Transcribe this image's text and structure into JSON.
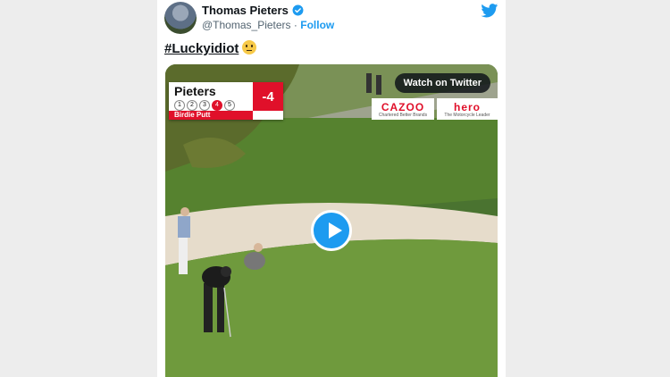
{
  "tweet": {
    "author_name": "Thomas Pieters",
    "handle": "@Thomas_Pieters",
    "separator": "·",
    "follow_label": "Follow",
    "hashtag": "#Luckyidiot",
    "emoji": "face-with-rolling-eyes-emoji"
  },
  "video": {
    "watch_label": "Watch on Twitter",
    "scoreboard": {
      "player": "Pieters",
      "holes": [
        "1",
        "2",
        "3",
        "4",
        "5"
      ],
      "current_hole_index": 3,
      "score": "-4",
      "status": "Birdie Putt"
    },
    "ads": {
      "left_brand": "CAZOO",
      "left_sub": "Chartered Better Brands",
      "right_brand": "hero",
      "right_sub": "The Motorcycle Leader"
    }
  },
  "colors": {
    "twitter_blue": "#1d9bf0",
    "score_red": "#e0102a"
  }
}
